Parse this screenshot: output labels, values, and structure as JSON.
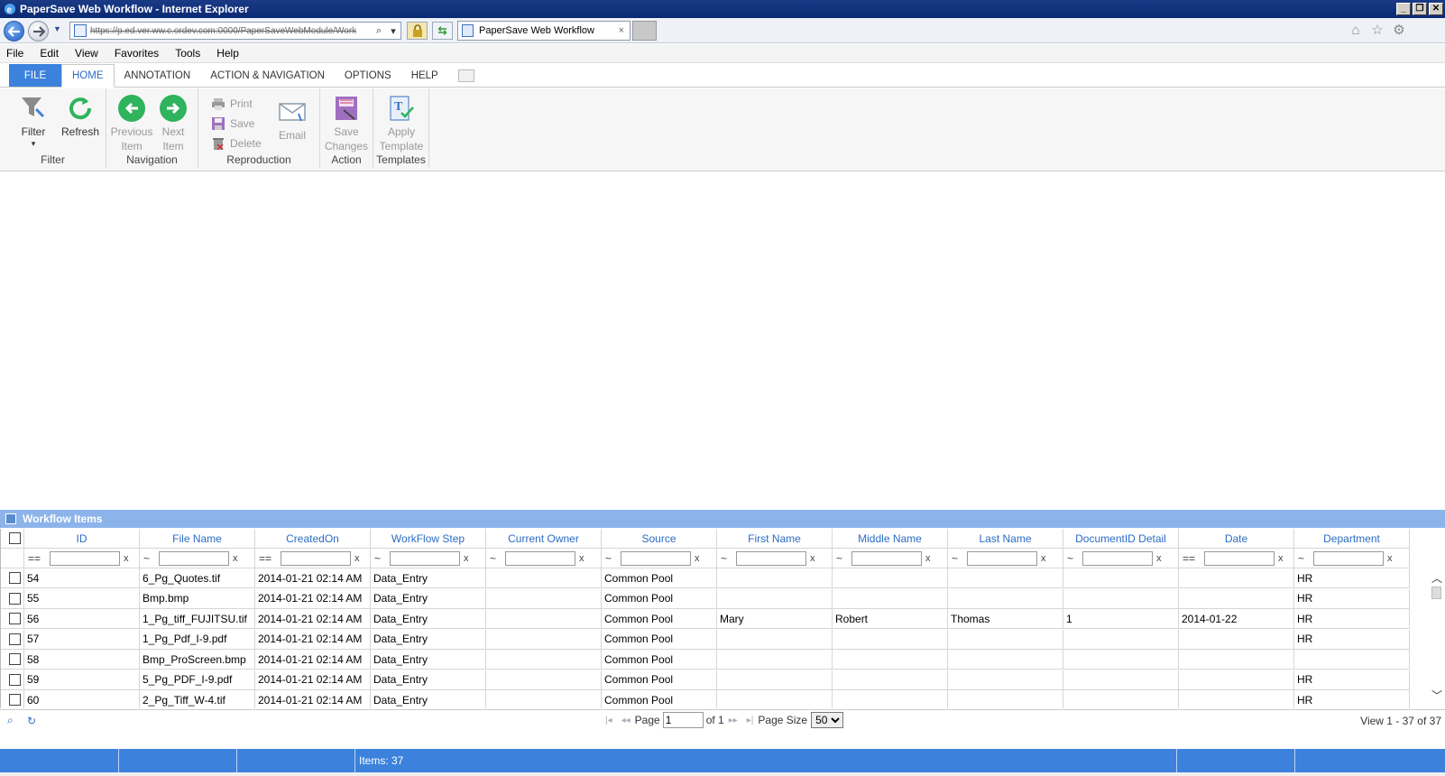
{
  "window": {
    "title": "PaperSave Web Workflow - Internet Explorer",
    "controls": [
      "_",
      "❐",
      "✕"
    ]
  },
  "addressbar": {
    "url": "https://p.ed.ver.ww.c.ordev.com:0000/PaperSaveWebModule/Work",
    "tab_title": "PaperSave Web Workflow",
    "tab_close": "×"
  },
  "menubar": [
    "File",
    "Edit",
    "View",
    "Favorites",
    "Tools",
    "Help"
  ],
  "ribbon_tabs": [
    "FILE",
    "HOME",
    "ANNOTATION",
    "ACTION & NAVIGATION",
    "OPTIONS",
    "HELP"
  ],
  "ribbon": {
    "filter": {
      "label": "Filter",
      "arrow": "▾",
      "group": "Filter"
    },
    "refresh": {
      "label": "Refresh"
    },
    "previous": {
      "label1": "Previous",
      "label2": "Item"
    },
    "next": {
      "label1": "Next",
      "label2": "Item"
    },
    "navigation_group": "Navigation",
    "print": "Print",
    "save": "Save",
    "delete": "Delete",
    "email": "Email",
    "reproduction_group": "Reproduction",
    "save_changes": {
      "label1": "Save",
      "label2": "Changes"
    },
    "action_group": "Action",
    "apply_template": {
      "label1": "Apply",
      "label2": "Template"
    },
    "templates_group": "Templates"
  },
  "grid": {
    "title": "Workflow Items",
    "columns": [
      "ID",
      "File Name",
      "CreatedOn",
      "WorkFlow Step",
      "Current Owner",
      "Source",
      "First Name",
      "Middle Name",
      "Last Name",
      "DocumentID Detail",
      "Date",
      "Department"
    ],
    "filter_ops": [
      "==",
      "~",
      "==",
      "~",
      "~",
      "~",
      "~",
      "~",
      "~",
      "~",
      "==",
      "~"
    ],
    "filter_clear": "x",
    "rows": [
      [
        "54",
        "6_Pg_Quotes.tif",
        "2014-01-21 02:14 AM",
        "Data_Entry",
        "",
        "Common Pool",
        "",
        "",
        "",
        "",
        "",
        "HR"
      ],
      [
        "55",
        "Bmp.bmp",
        "2014-01-21 02:14 AM",
        "Data_Entry",
        "",
        "Common Pool",
        "",
        "",
        "",
        "",
        "",
        "HR"
      ],
      [
        "56",
        "1_Pg_tiff_FUJITSU.tif",
        "2014-01-21 02:14 AM",
        "Data_Entry",
        "",
        "Common Pool",
        "Mary",
        "Robert",
        "Thomas",
        "1",
        "2014-01-22",
        "HR"
      ],
      [
        "57",
        "1_Pg_Pdf_I-9.pdf",
        "2014-01-21 02:14 AM",
        "Data_Entry",
        "",
        "Common Pool",
        "",
        "",
        "",
        "",
        "",
        "HR"
      ],
      [
        "58",
        "Bmp_ProScreen.bmp",
        "2014-01-21 02:14 AM",
        "Data_Entry",
        "",
        "Common Pool",
        "",
        "",
        "",
        "",
        "",
        ""
      ],
      [
        "59",
        "5_Pg_PDF_I-9.pdf",
        "2014-01-21 02:14 AM",
        "Data_Entry",
        "",
        "Common Pool",
        "",
        "",
        "",
        "",
        "",
        "HR"
      ],
      [
        "60",
        "2_Pg_Tiff_W-4.tif",
        "2014-01-21 02:14 AM",
        "Data_Entry",
        "",
        "Common Pool",
        "",
        "",
        "",
        "",
        "",
        "HR"
      ]
    ]
  },
  "pager": {
    "page_label": "Page",
    "page_value": "1",
    "of_label": "of 1",
    "page_size_label": "Page Size",
    "page_size": "50",
    "view_text": "View 1 - 37 of 37"
  },
  "status": {
    "items": "Items: 37"
  },
  "colors": {
    "accent": "#3c82dc",
    "link": "#2b6cc4",
    "header_band": "#8db4ea"
  }
}
